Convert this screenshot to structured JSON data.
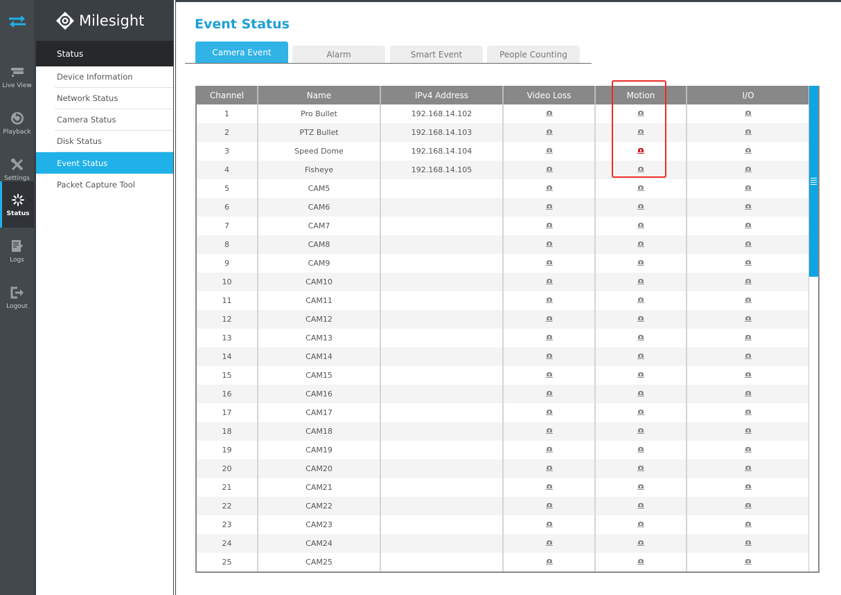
{
  "app": {
    "brand": "Milesight"
  },
  "rail": {
    "items": [
      {
        "label": "Live View",
        "icon": "live-view-icon"
      },
      {
        "label": "Playback",
        "icon": "playback-icon"
      },
      {
        "label": "Settings",
        "icon": "settings-icon"
      },
      {
        "label": "Status",
        "icon": "status-icon",
        "active": true
      },
      {
        "label": "Logs",
        "icon": "logs-icon"
      },
      {
        "label": "Logout",
        "icon": "logout-icon"
      }
    ]
  },
  "submenu": {
    "header": "Status",
    "items": [
      {
        "label": "Device Information"
      },
      {
        "label": "Network Status"
      },
      {
        "label": "Camera Status"
      },
      {
        "label": "Disk Status"
      },
      {
        "label": "Event Status",
        "active": true
      },
      {
        "label": "Packet Capture Tool"
      }
    ]
  },
  "page": {
    "title": "Event Status",
    "tabs": [
      {
        "label": "Camera Event",
        "active": true
      },
      {
        "label": "Alarm"
      },
      {
        "label": "Smart Event"
      },
      {
        "label": "People Counting"
      }
    ]
  },
  "table": {
    "columns": [
      "Channel",
      "Name",
      "IPv4 Address",
      "Video Loss",
      "Motion",
      "I/O"
    ],
    "rows": [
      {
        "channel": "1",
        "name": "Pro Bullet",
        "ip": "192.168.14.102",
        "video_loss": "off",
        "motion": "off",
        "io": "off"
      },
      {
        "channel": "2",
        "name": "PTZ Bullet",
        "ip": "192.168.14.103",
        "video_loss": "off",
        "motion": "off",
        "io": "off"
      },
      {
        "channel": "3",
        "name": "Speed Dome",
        "ip": "192.168.14.104",
        "video_loss": "off",
        "motion": "on",
        "io": "off"
      },
      {
        "channel": "4",
        "name": "Fisheye",
        "ip": "192.168.14.105",
        "video_loss": "off",
        "motion": "off",
        "io": "off"
      },
      {
        "channel": "5",
        "name": "CAM5",
        "ip": "",
        "video_loss": "off",
        "motion": "off",
        "io": "off"
      },
      {
        "channel": "6",
        "name": "CAM6",
        "ip": "",
        "video_loss": "off",
        "motion": "off",
        "io": "off"
      },
      {
        "channel": "7",
        "name": "CAM7",
        "ip": "",
        "video_loss": "off",
        "motion": "off",
        "io": "off"
      },
      {
        "channel": "8",
        "name": "CAM8",
        "ip": "",
        "video_loss": "off",
        "motion": "off",
        "io": "off"
      },
      {
        "channel": "9",
        "name": "CAM9",
        "ip": "",
        "video_loss": "off",
        "motion": "off",
        "io": "off"
      },
      {
        "channel": "10",
        "name": "CAM10",
        "ip": "",
        "video_loss": "off",
        "motion": "off",
        "io": "off"
      },
      {
        "channel": "11",
        "name": "CAM11",
        "ip": "",
        "video_loss": "off",
        "motion": "off",
        "io": "off"
      },
      {
        "channel": "12",
        "name": "CAM12",
        "ip": "",
        "video_loss": "off",
        "motion": "off",
        "io": "off"
      },
      {
        "channel": "13",
        "name": "CAM13",
        "ip": "",
        "video_loss": "off",
        "motion": "off",
        "io": "off"
      },
      {
        "channel": "14",
        "name": "CAM14",
        "ip": "",
        "video_loss": "off",
        "motion": "off",
        "io": "off"
      },
      {
        "channel": "15",
        "name": "CAM15",
        "ip": "",
        "video_loss": "off",
        "motion": "off",
        "io": "off"
      },
      {
        "channel": "16",
        "name": "CAM16",
        "ip": "",
        "video_loss": "off",
        "motion": "off",
        "io": "off"
      },
      {
        "channel": "17",
        "name": "CAM17",
        "ip": "",
        "video_loss": "off",
        "motion": "off",
        "io": "off"
      },
      {
        "channel": "18",
        "name": "CAM18",
        "ip": "",
        "video_loss": "off",
        "motion": "off",
        "io": "off"
      },
      {
        "channel": "19",
        "name": "CAM19",
        "ip": "",
        "video_loss": "off",
        "motion": "off",
        "io": "off"
      },
      {
        "channel": "20",
        "name": "CAM20",
        "ip": "",
        "video_loss": "off",
        "motion": "off",
        "io": "off"
      },
      {
        "channel": "21",
        "name": "CAM21",
        "ip": "",
        "video_loss": "off",
        "motion": "off",
        "io": "off"
      },
      {
        "channel": "22",
        "name": "CAM22",
        "ip": "",
        "video_loss": "off",
        "motion": "off",
        "io": "off"
      },
      {
        "channel": "23",
        "name": "CAM23",
        "ip": "",
        "video_loss": "off",
        "motion": "off",
        "io": "off"
      },
      {
        "channel": "24",
        "name": "CAM24",
        "ip": "",
        "video_loss": "off",
        "motion": "off",
        "io": "off"
      },
      {
        "channel": "25",
        "name": "CAM25",
        "ip": "",
        "video_loss": "off",
        "motion": "off",
        "io": "off"
      }
    ]
  },
  "colors": {
    "accent": "#1fb1e8",
    "alarm_active": "#d0181f",
    "alarm_idle": "#8d8d8d",
    "highlight": "#ee2a24"
  }
}
